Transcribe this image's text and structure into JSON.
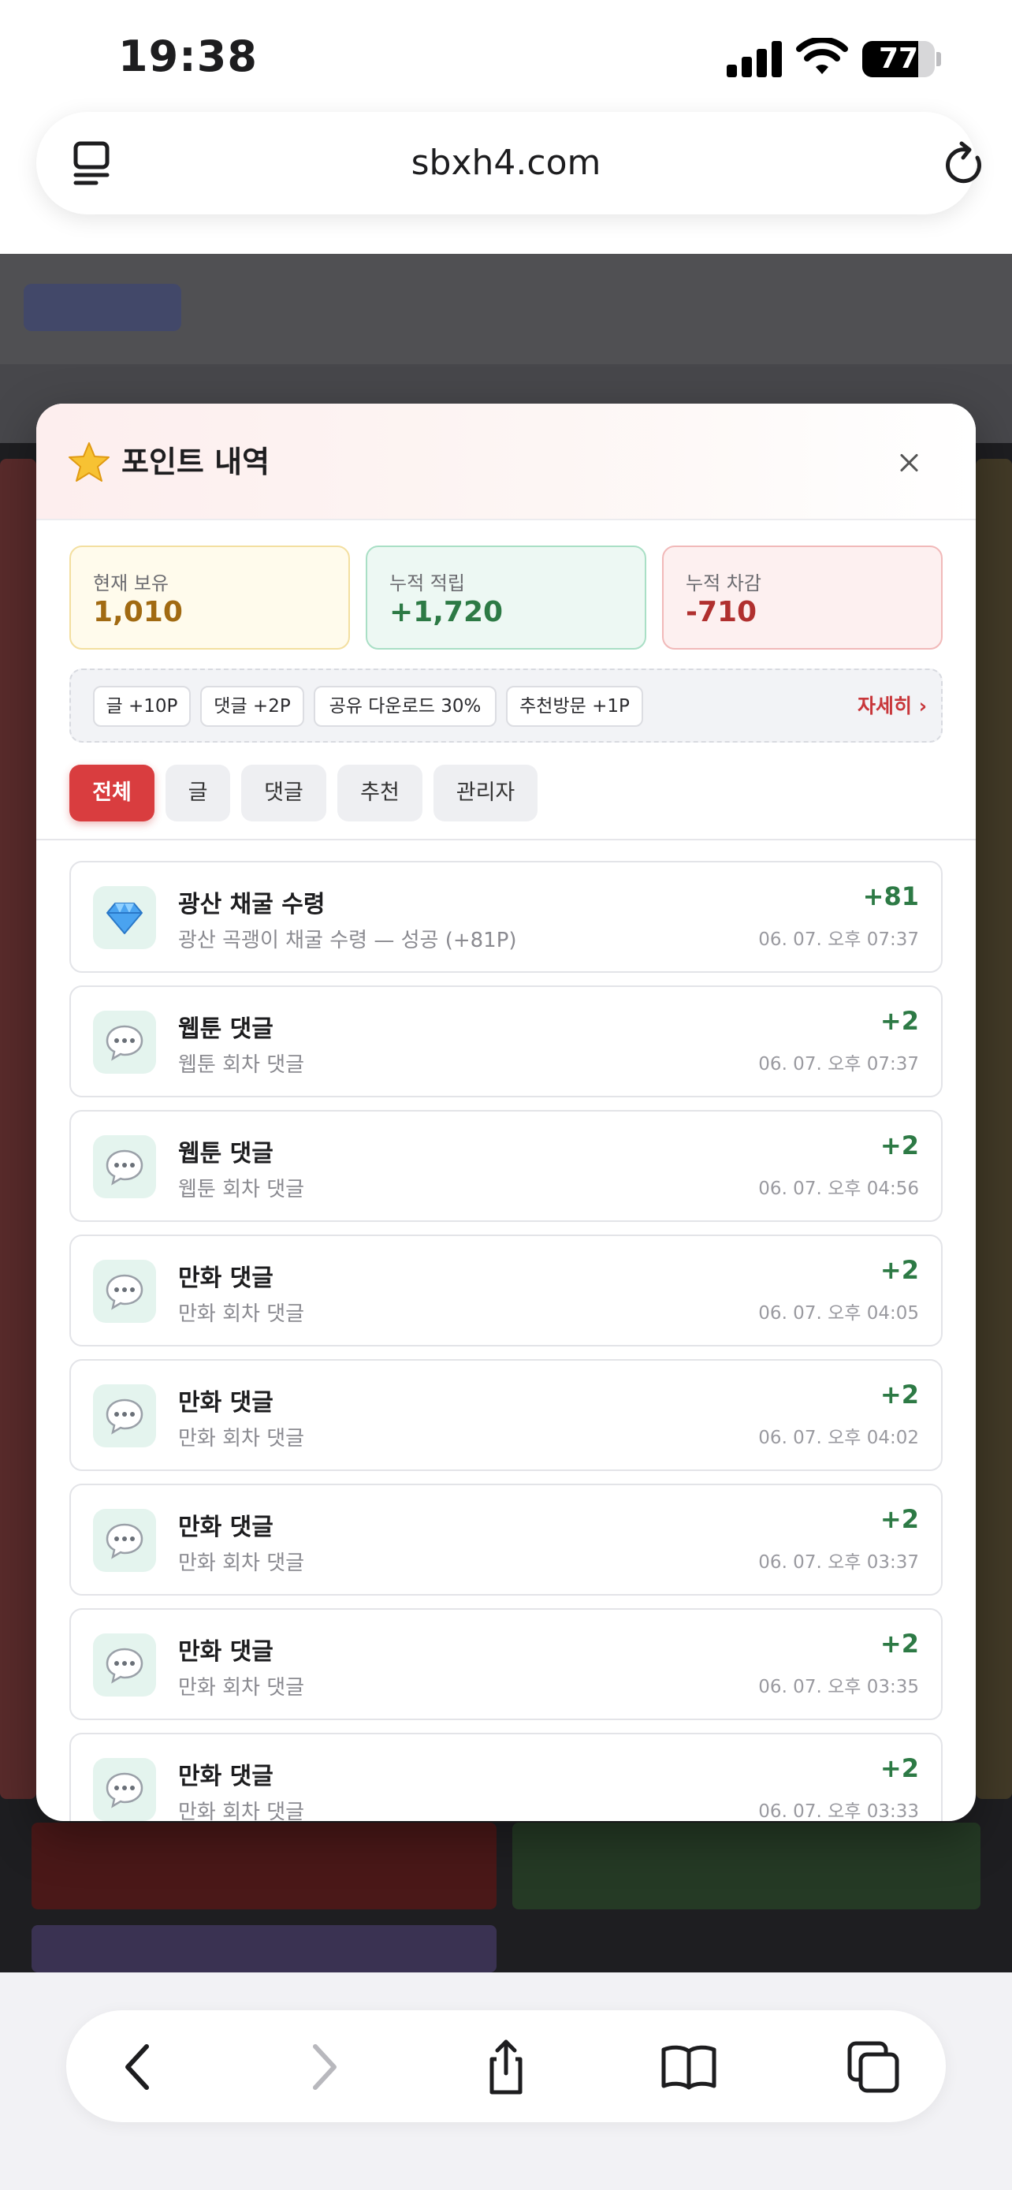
{
  "status_bar": {
    "time": "19:38",
    "battery": "77",
    "battery_level": 0.77
  },
  "browser": {
    "url": "sbxh4.com"
  },
  "modal": {
    "title": "포인트 내역",
    "summary": [
      {
        "label": "현재 보유",
        "value": "1,010"
      },
      {
        "label": "누적 적립",
        "value": "+1,720"
      },
      {
        "label": "누적 차감",
        "value": "-710"
      }
    ],
    "rules": [
      "글 +10P",
      "댓글 +2P",
      "공유 다운로드 30%",
      "추천방문 +1P"
    ],
    "rules_link": "자세히 ›",
    "tabs": [
      "전체",
      "글",
      "댓글",
      "추천",
      "관리자"
    ],
    "active_tab": "전체",
    "items": [
      {
        "icon": "gem-icon",
        "title": "광산 채굴 수령",
        "desc": "광산 곡괭이 채굴 수령 — 성공 (+81P)",
        "amount": "+81",
        "time": "06. 07. 오후 07:37"
      },
      {
        "icon": "speech-bubble-icon",
        "title": "웹툰 댓글",
        "desc": "웹툰 회차 댓글",
        "amount": "+2",
        "time": "06. 07. 오후 07:37"
      },
      {
        "icon": "speech-bubble-icon",
        "title": "웹툰 댓글",
        "desc": "웹툰 회차 댓글",
        "amount": "+2",
        "time": "06. 07. 오후 04:56"
      },
      {
        "icon": "speech-bubble-icon",
        "title": "만화 댓글",
        "desc": "만화 회차 댓글",
        "amount": "+2",
        "time": "06. 07. 오후 04:05"
      },
      {
        "icon": "speech-bubble-icon",
        "title": "만화 댓글",
        "desc": "만화 회차 댓글",
        "amount": "+2",
        "time": "06. 07. 오후 04:02"
      },
      {
        "icon": "speech-bubble-icon",
        "title": "만화 댓글",
        "desc": "만화 회차 댓글",
        "amount": "+2",
        "time": "06. 07. 오후 03:37"
      },
      {
        "icon": "speech-bubble-icon",
        "title": "만화 댓글",
        "desc": "만화 회차 댓글",
        "amount": "+2",
        "time": "06. 07. 오후 03:35"
      },
      {
        "icon": "speech-bubble-icon",
        "title": "만화 댓글",
        "desc": "만화 회차 댓글",
        "amount": "+2",
        "time": "06. 07. 오후 03:33"
      }
    ]
  },
  "toolbar": {
    "buttons": [
      "back-icon",
      "forward-icon",
      "share-icon",
      "bookmarks-icon",
      "tabs-icon"
    ]
  }
}
